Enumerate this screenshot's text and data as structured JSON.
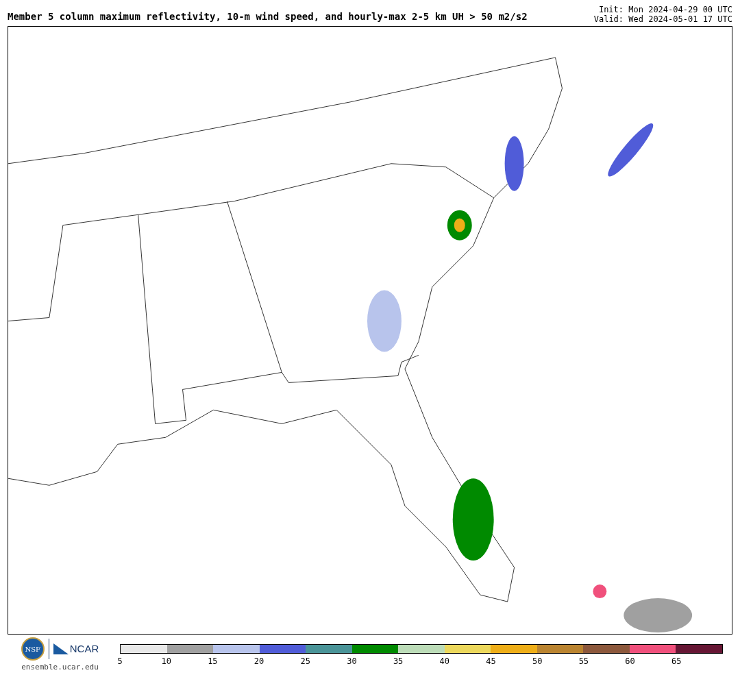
{
  "header": {
    "title": "Member 5 column maximum reflectivity, 10-m wind speed, and hourly-max 2-5 km UH > 50 m2/s2",
    "init": "Init: Mon 2024-04-29 00 UTC",
    "valid": "Valid: Wed 2024-05-01 17 UTC"
  },
  "footer": {
    "nsf_logo": "NSF",
    "ncar_logo": "NCAR",
    "site": "ensemble.ucar.edu"
  },
  "colorbar": {
    "segments": [
      {
        "color": "#e8e8e8",
        "tick": "5"
      },
      {
        "color": "#a0a0a0",
        "tick": "10"
      },
      {
        "color": "#b8c4ec",
        "tick": "15"
      },
      {
        "color": "#505cd8",
        "tick": "20"
      },
      {
        "color": "#4a9498",
        "tick": "25"
      },
      {
        "color": "#008a00",
        "tick": "30"
      },
      {
        "color": "#bcdcb8",
        "tick": "35"
      },
      {
        "color": "#ecd85c",
        "tick": "40"
      },
      {
        "color": "#eeae18",
        "tick": "45"
      },
      {
        "color": "#ba8430",
        "tick": "50"
      },
      {
        "color": "#8c583c",
        "tick": "55"
      },
      {
        "color": "#f0507c",
        "tick": "60"
      },
      {
        "color": "#661634",
        "tick": "65"
      }
    ]
  }
}
